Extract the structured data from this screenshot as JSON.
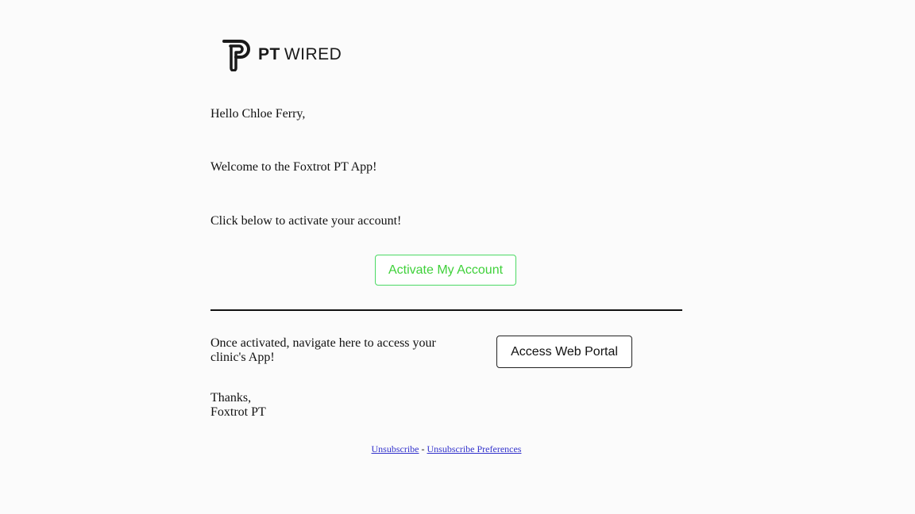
{
  "logo": {
    "icon": "pt-wired-logo-icon",
    "brand_bold": "PT",
    "brand_regular": "WIRED"
  },
  "email": {
    "greeting": "Hello Chloe Ferry,",
    "welcome": "Welcome to the Foxtrot PT App!",
    "click_below": "Click below to activate your account!",
    "activate_label": "Activate My Account",
    "navigate_text": "Once activated, navigate here to access your clinic's App!",
    "portal_label": "Access Web Portal",
    "thanks": "Thanks,",
    "signature": "Foxtrot PT"
  },
  "footer": {
    "unsubscribe": "Unsubscribe",
    "separator": "-",
    "unsubscribe_preferences": "Unsubscribe Preferences"
  },
  "colors": {
    "activate_accent": "#3fd13a",
    "link": "#3333cc"
  }
}
